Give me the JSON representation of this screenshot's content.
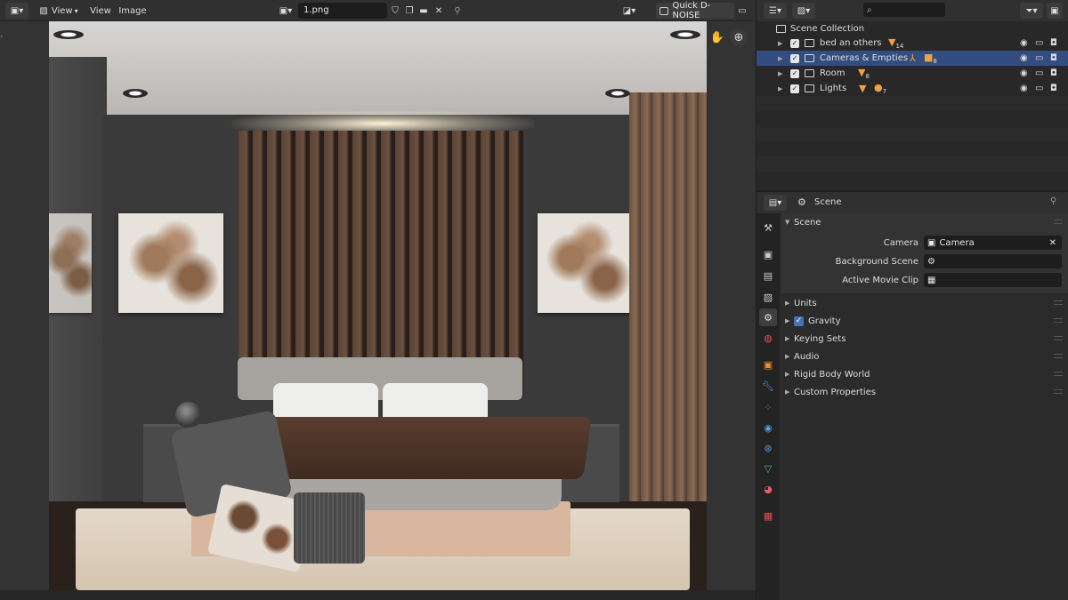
{
  "image_editor": {
    "header": {
      "view_label": "View",
      "view_menu_label": "View",
      "image_menu_label": "Image",
      "filename": "1.png",
      "quick_denoise_label": "Quick D-NOISE"
    },
    "icons": {
      "editor_type": "image-editor-icon",
      "mode": "view-mode-icon",
      "pan": "hand-icon",
      "zoom": "magnifier-icon"
    }
  },
  "outliner": {
    "search_placeholder": "",
    "root_label": "Scene Collection",
    "rows": [
      {
        "label": "bed an others",
        "badge_count": "14",
        "selected": false
      },
      {
        "label": "Cameras & Empties",
        "badge_count": "8",
        "selected": true
      },
      {
        "label": "Room",
        "badge_count": "8",
        "selected": false
      },
      {
        "label": "Lights",
        "badge_count": "7",
        "selected": false
      }
    ]
  },
  "properties": {
    "context_label": "Scene",
    "panel_scene_label": "Scene",
    "fields": {
      "camera_label": "Camera",
      "camera_value": "Camera",
      "background_scene_label": "Background Scene",
      "active_movie_clip_label": "Active Movie Clip"
    },
    "panels": {
      "units": "Units",
      "gravity": "Gravity",
      "keying_sets": "Keying Sets",
      "audio": "Audio",
      "rigid_body_world": "Rigid Body World",
      "custom_properties": "Custom Properties"
    },
    "colors": {
      "selected_row": "#334d80",
      "checkbox_accent": "#4772b3",
      "object_badge": "#f0a040"
    }
  }
}
